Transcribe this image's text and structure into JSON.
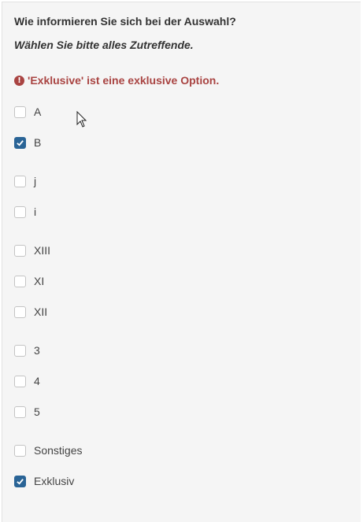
{
  "question": {
    "title": "Wie informieren Sie sich bei der Auswahl?",
    "help": "Wählen Sie bitte alles Zutreffende.",
    "error_icon_glyph": "!",
    "error": "'Exklusive' ist eine exklusive Option."
  },
  "options": [
    {
      "label": "A",
      "checked": false
    },
    {
      "label": "B",
      "checked": true
    },
    {
      "label": "j",
      "checked": false
    },
    {
      "label": "i",
      "checked": false
    },
    {
      "label": "XIII",
      "checked": false
    },
    {
      "label": "XI",
      "checked": false
    },
    {
      "label": "XII",
      "checked": false
    },
    {
      "label": "3",
      "checked": false
    },
    {
      "label": "4",
      "checked": false
    },
    {
      "label": "5",
      "checked": false
    },
    {
      "label": "Sonstiges",
      "checked": false
    },
    {
      "label": "Exklusiv",
      "checked": true
    }
  ],
  "colors": {
    "error": "#a94442",
    "checkbox_checked": "#2a6496",
    "panel_background": "#f5f5f5"
  }
}
